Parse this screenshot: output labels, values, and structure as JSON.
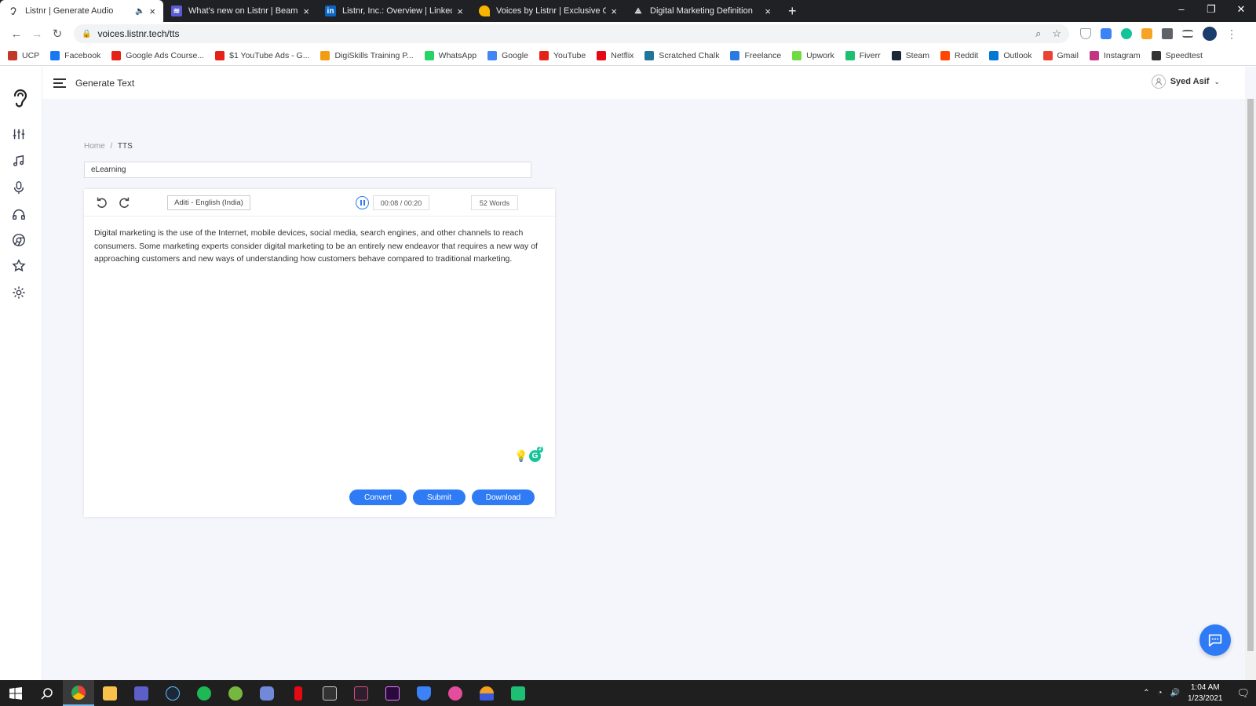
{
  "browser": {
    "tabs": [
      {
        "title": "Listnr | Generate Audio",
        "active": true,
        "fav_color": "#ffffff"
      },
      {
        "title": "What's new on Listnr | Beamer",
        "active": false,
        "fav_color": "#5b5bd6"
      },
      {
        "title": "Listnr, Inc.: Overview | LinkedIn",
        "active": false,
        "fav_color": "#0a66c2"
      },
      {
        "title": "Voices by Listnr | Exclusive Offer",
        "active": false,
        "fav_color": "#f7b500"
      },
      {
        "title": "Digital Marketing Definition",
        "active": false,
        "fav_color": "#9aa0a6"
      }
    ],
    "new_tab_label": "+",
    "url": "voices.listnr.tech/tts",
    "bookmarks": [
      {
        "label": "UCP",
        "color": "#c0392b"
      },
      {
        "label": "Facebook",
        "color": "#1877f2"
      },
      {
        "label": "Google Ads Course...",
        "color": "#e62117"
      },
      {
        "label": "$1 YouTube Ads - G...",
        "color": "#e62117"
      },
      {
        "label": "DigiSkills Training P...",
        "color": "#f39c12"
      },
      {
        "label": "WhatsApp",
        "color": "#25d366"
      },
      {
        "label": "Google",
        "color": "#4285f4"
      },
      {
        "label": "YouTube",
        "color": "#e62117"
      },
      {
        "label": "Netflix",
        "color": "#e50914"
      },
      {
        "label": "Scratched Chalk",
        "color": "#21759b"
      },
      {
        "label": "Freelance",
        "color": "#2a7ae2"
      },
      {
        "label": "Upwork",
        "color": "#6fda44"
      },
      {
        "label": "Fiverr",
        "color": "#1dbf73"
      },
      {
        "label": "Steam",
        "color": "#1b2838"
      },
      {
        "label": "Reddit",
        "color": "#ff4500"
      },
      {
        "label": "Outlook",
        "color": "#0078d4"
      },
      {
        "label": "Gmail",
        "color": "#ea4335"
      },
      {
        "label": "Instagram",
        "color": "#c13584"
      },
      {
        "label": "Speedtest",
        "color": "#333333"
      }
    ]
  },
  "app": {
    "header_title": "Generate Text",
    "user_name": "Syed Asif",
    "breadcrumb": {
      "home": "Home",
      "separator": "/",
      "current": "TTS"
    },
    "project_name": "eLearning",
    "editor": {
      "voice": "Aditi - English (India)",
      "time": "00:08 / 00:20",
      "word_count": "52 Words",
      "text": "Digital marketing is the use of the Internet, mobile devices, social media, search engines, and other channels to reach consumers. Some marketing experts consider digital marketing to be an entirely new endeavor that requires a new way of approaching customers and new ways of understanding how customers behave compared to traditional marketing."
    },
    "buttons": {
      "convert": "Convert",
      "submit": "Submit",
      "download": "Download"
    },
    "accent_color": "#2f7bf5",
    "sidebar_icons": [
      "sliders-icon",
      "music-icon",
      "microphone-icon",
      "headphones-icon",
      "chrome-icon",
      "star-icon",
      "gear-icon"
    ]
  },
  "taskbar": {
    "time": "1:04 AM",
    "date": "1/23/2021"
  }
}
